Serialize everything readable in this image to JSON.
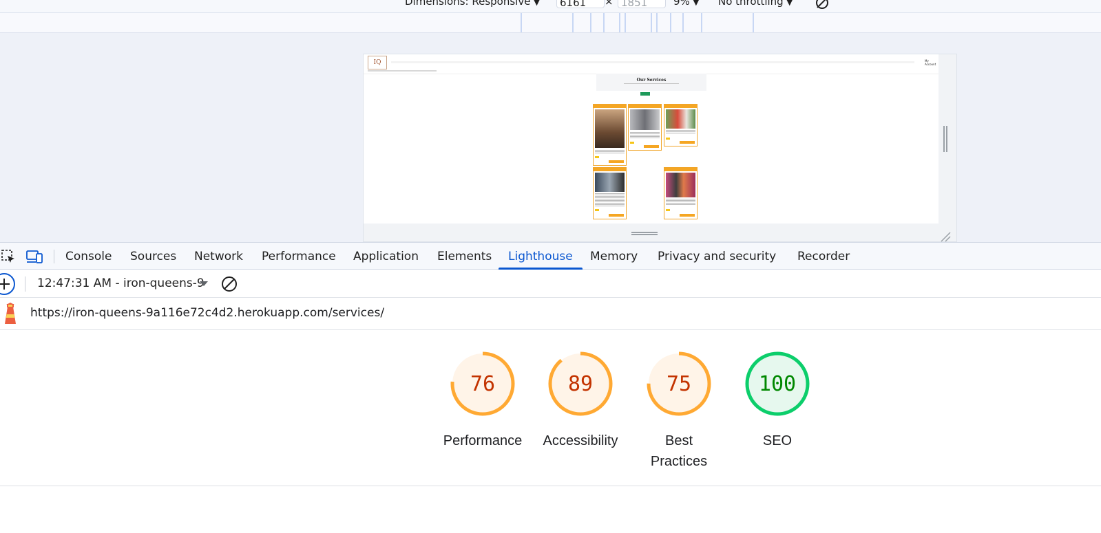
{
  "device_toolbar": {
    "dimensions_label": "Dimensions: Responsive",
    "width_value": "6161",
    "height_value": "1851",
    "zoom": "9%",
    "throttling": "No throttling"
  },
  "preview": {
    "page_title": "Our Services",
    "account_label": "My Account"
  },
  "tabs": [
    {
      "label": "Console"
    },
    {
      "label": "Sources"
    },
    {
      "label": "Network"
    },
    {
      "label": "Performance"
    },
    {
      "label": "Application"
    },
    {
      "label": "Elements"
    },
    {
      "label": "Lighthouse",
      "active": true
    },
    {
      "label": "Memory"
    },
    {
      "label": "Privacy and security"
    },
    {
      "label": "Recorder"
    }
  ],
  "lighthouse": {
    "report_selector": "12:47:31 AM - iron-queens-9",
    "url": "https://iron-queens-9a116e72c4d2.herokuapp.com/services/",
    "scores": [
      {
        "label": "Performance",
        "value": 76,
        "rating": "average"
      },
      {
        "label": "Accessibility",
        "value": 89,
        "rating": "average"
      },
      {
        "label": "Best Practices",
        "value": 75,
        "rating": "average"
      },
      {
        "label": "SEO",
        "value": 100,
        "rating": "pass"
      }
    ]
  },
  "colors": {
    "average_stroke": "#ffa933",
    "average_fill": "#fff4e8",
    "average_text": "#c33300",
    "pass_stroke": "#0cce6b",
    "pass_fill": "#e6f8ee",
    "pass_text": "#008800",
    "accent": "#0b57d0"
  }
}
